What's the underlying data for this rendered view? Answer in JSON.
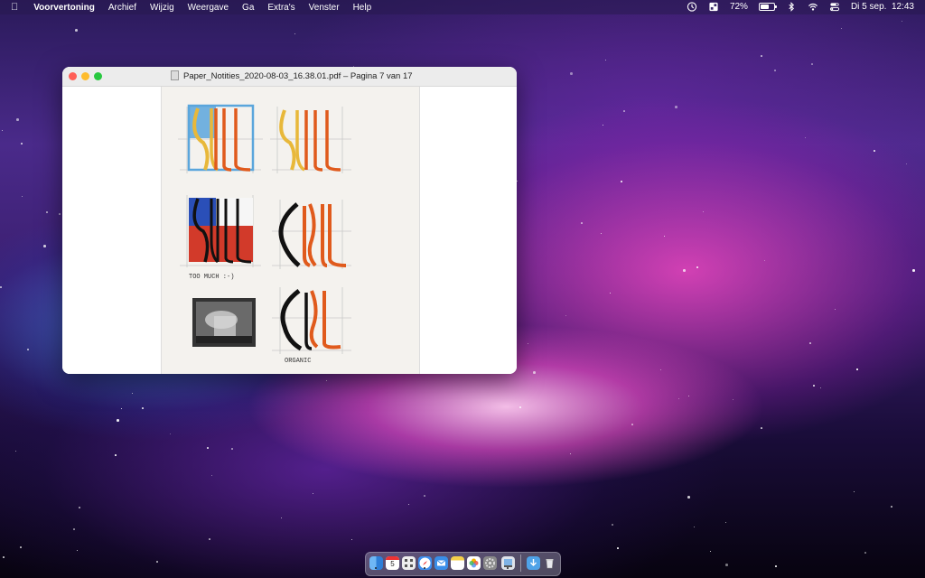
{
  "menubar": {
    "app_name": "Voorvertoning",
    "menus": [
      "Archief",
      "Wijzig",
      "Weergave",
      "Ga",
      "Extra's",
      "Venster",
      "Help"
    ],
    "battery_percent": "72%",
    "datetime": "Di 5 sep.  12:43"
  },
  "window": {
    "title": "Paper_Notities_2020-08-03_16.38.01.pdf – Pagina 7 van 17",
    "annotations": {
      "too_much": "TOO MUCH :-)",
      "organic": "ORGANIC"
    }
  },
  "dock": {
    "apps": [
      "finder",
      "calendar",
      "launchpad",
      "safari",
      "mail",
      "notes",
      "photos",
      "system-settings",
      "preview",
      "downloads",
      "trash"
    ],
    "calendar_day": "5"
  },
  "colors": {
    "accent_red": "#e05a1c",
    "accent_yellow": "#e8b83a",
    "accent_blue": "#5aa6dc",
    "flag_blue": "#2a4fb8",
    "flag_red": "#d23a2a"
  }
}
